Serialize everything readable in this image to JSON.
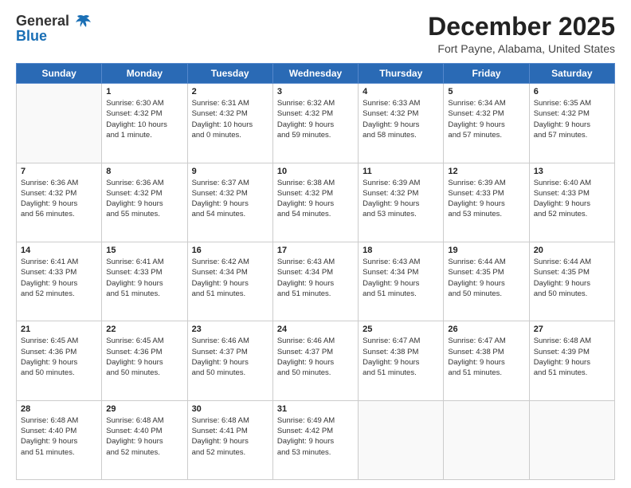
{
  "header": {
    "logo_line1": "General",
    "logo_line2": "Blue",
    "main_title": "December 2025",
    "subtitle": "Fort Payne, Alabama, United States"
  },
  "calendar": {
    "days_of_week": [
      "Sunday",
      "Monday",
      "Tuesday",
      "Wednesday",
      "Thursday",
      "Friday",
      "Saturday"
    ],
    "weeks": [
      [
        {
          "day": "",
          "info": ""
        },
        {
          "day": "1",
          "info": "Sunrise: 6:30 AM\nSunset: 4:32 PM\nDaylight: 10 hours\nand 1 minute."
        },
        {
          "day": "2",
          "info": "Sunrise: 6:31 AM\nSunset: 4:32 PM\nDaylight: 10 hours\nand 0 minutes."
        },
        {
          "day": "3",
          "info": "Sunrise: 6:32 AM\nSunset: 4:32 PM\nDaylight: 9 hours\nand 59 minutes."
        },
        {
          "day": "4",
          "info": "Sunrise: 6:33 AM\nSunset: 4:32 PM\nDaylight: 9 hours\nand 58 minutes."
        },
        {
          "day": "5",
          "info": "Sunrise: 6:34 AM\nSunset: 4:32 PM\nDaylight: 9 hours\nand 57 minutes."
        },
        {
          "day": "6",
          "info": "Sunrise: 6:35 AM\nSunset: 4:32 PM\nDaylight: 9 hours\nand 57 minutes."
        }
      ],
      [
        {
          "day": "7",
          "info": "Sunrise: 6:36 AM\nSunset: 4:32 PM\nDaylight: 9 hours\nand 56 minutes."
        },
        {
          "day": "8",
          "info": "Sunrise: 6:36 AM\nSunset: 4:32 PM\nDaylight: 9 hours\nand 55 minutes."
        },
        {
          "day": "9",
          "info": "Sunrise: 6:37 AM\nSunset: 4:32 PM\nDaylight: 9 hours\nand 54 minutes."
        },
        {
          "day": "10",
          "info": "Sunrise: 6:38 AM\nSunset: 4:32 PM\nDaylight: 9 hours\nand 54 minutes."
        },
        {
          "day": "11",
          "info": "Sunrise: 6:39 AM\nSunset: 4:32 PM\nDaylight: 9 hours\nand 53 minutes."
        },
        {
          "day": "12",
          "info": "Sunrise: 6:39 AM\nSunset: 4:33 PM\nDaylight: 9 hours\nand 53 minutes."
        },
        {
          "day": "13",
          "info": "Sunrise: 6:40 AM\nSunset: 4:33 PM\nDaylight: 9 hours\nand 52 minutes."
        }
      ],
      [
        {
          "day": "14",
          "info": "Sunrise: 6:41 AM\nSunset: 4:33 PM\nDaylight: 9 hours\nand 52 minutes."
        },
        {
          "day": "15",
          "info": "Sunrise: 6:41 AM\nSunset: 4:33 PM\nDaylight: 9 hours\nand 51 minutes."
        },
        {
          "day": "16",
          "info": "Sunrise: 6:42 AM\nSunset: 4:34 PM\nDaylight: 9 hours\nand 51 minutes."
        },
        {
          "day": "17",
          "info": "Sunrise: 6:43 AM\nSunset: 4:34 PM\nDaylight: 9 hours\nand 51 minutes."
        },
        {
          "day": "18",
          "info": "Sunrise: 6:43 AM\nSunset: 4:34 PM\nDaylight: 9 hours\nand 51 minutes."
        },
        {
          "day": "19",
          "info": "Sunrise: 6:44 AM\nSunset: 4:35 PM\nDaylight: 9 hours\nand 50 minutes."
        },
        {
          "day": "20",
          "info": "Sunrise: 6:44 AM\nSunset: 4:35 PM\nDaylight: 9 hours\nand 50 minutes."
        }
      ],
      [
        {
          "day": "21",
          "info": "Sunrise: 6:45 AM\nSunset: 4:36 PM\nDaylight: 9 hours\nand 50 minutes."
        },
        {
          "day": "22",
          "info": "Sunrise: 6:45 AM\nSunset: 4:36 PM\nDaylight: 9 hours\nand 50 minutes."
        },
        {
          "day": "23",
          "info": "Sunrise: 6:46 AM\nSunset: 4:37 PM\nDaylight: 9 hours\nand 50 minutes."
        },
        {
          "day": "24",
          "info": "Sunrise: 6:46 AM\nSunset: 4:37 PM\nDaylight: 9 hours\nand 50 minutes."
        },
        {
          "day": "25",
          "info": "Sunrise: 6:47 AM\nSunset: 4:38 PM\nDaylight: 9 hours\nand 51 minutes."
        },
        {
          "day": "26",
          "info": "Sunrise: 6:47 AM\nSunset: 4:38 PM\nDaylight: 9 hours\nand 51 minutes."
        },
        {
          "day": "27",
          "info": "Sunrise: 6:48 AM\nSunset: 4:39 PM\nDaylight: 9 hours\nand 51 minutes."
        }
      ],
      [
        {
          "day": "28",
          "info": "Sunrise: 6:48 AM\nSunset: 4:40 PM\nDaylight: 9 hours\nand 51 minutes."
        },
        {
          "day": "29",
          "info": "Sunrise: 6:48 AM\nSunset: 4:40 PM\nDaylight: 9 hours\nand 52 minutes."
        },
        {
          "day": "30",
          "info": "Sunrise: 6:48 AM\nSunset: 4:41 PM\nDaylight: 9 hours\nand 52 minutes."
        },
        {
          "day": "31",
          "info": "Sunrise: 6:49 AM\nSunset: 4:42 PM\nDaylight: 9 hours\nand 53 minutes."
        },
        {
          "day": "",
          "info": ""
        },
        {
          "day": "",
          "info": ""
        },
        {
          "day": "",
          "info": ""
        }
      ]
    ]
  }
}
